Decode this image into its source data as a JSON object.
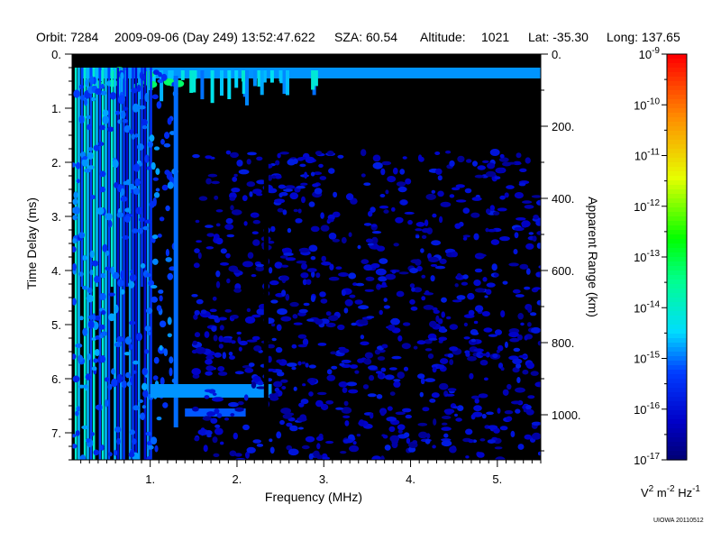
{
  "header": {
    "orbit": "Orbit: 7284",
    "datetime": "2009-09-06 (Day 249) 13:52:47.622",
    "sza": "SZA:  60.54",
    "altitude_label": "Altitude:",
    "altitude_value": "1021",
    "lat": "Lat: -35.30",
    "long": "Long: 137.65"
  },
  "credit": "UIOWA 20110512",
  "colors": {
    "background": "#000000",
    "low": "#0000c8",
    "mid": "#00e6ff",
    "high": "#00ff00",
    "yellow": "#ffff00",
    "max": "#ff0000"
  },
  "chart_data": {
    "type": "heatmap",
    "xlabel": "Frequency (MHz)",
    "ylabel": "Time Delay (ms)",
    "y2label": "Apparent Range (km)",
    "colorbar_unit": "V^2 m^-2 Hz^-1",
    "xlim": [
      0.1,
      5.5
    ],
    "ylim": [
      0,
      7.5
    ],
    "y2lim": [
      0,
      1125
    ],
    "x_ticks": [
      {
        "value": 1,
        "label": "1."
      },
      {
        "value": 2,
        "label": "2."
      },
      {
        "value": 3,
        "label": "3."
      },
      {
        "value": 4,
        "label": "4."
      },
      {
        "value": 5,
        "label": "5."
      }
    ],
    "y_ticks": [
      {
        "value": 0,
        "label": "0."
      },
      {
        "value": 1,
        "label": "1."
      },
      {
        "value": 2,
        "label": "2."
      },
      {
        "value": 3,
        "label": "3."
      },
      {
        "value": 4,
        "label": "4."
      },
      {
        "value": 5,
        "label": "5."
      },
      {
        "value": 6,
        "label": "6."
      },
      {
        "value": 7,
        "label": "7."
      }
    ],
    "y2_ticks": [
      {
        "value": 0,
        "label": "0."
      },
      {
        "value": 200,
        "label": "200."
      },
      {
        "value": 400,
        "label": "400."
      },
      {
        "value": 600,
        "label": "600."
      },
      {
        "value": 800,
        "label": "800."
      },
      {
        "value": 1000,
        "label": "1000."
      }
    ],
    "colorbar": {
      "scale": "log",
      "range": [
        -17,
        -9
      ],
      "ticks": [
        {
          "value": -9,
          "base": "10",
          "exp": "-9"
        },
        {
          "value": -10,
          "base": "10",
          "exp": "-10"
        },
        {
          "value": -11,
          "base": "10",
          "exp": "-11"
        },
        {
          "value": -12,
          "base": "10",
          "exp": "-12"
        },
        {
          "value": -13,
          "base": "10",
          "exp": "-13"
        },
        {
          "value": -14,
          "base": "10",
          "exp": "-14"
        },
        {
          "value": -15,
          "base": "10",
          "exp": "-15"
        },
        {
          "value": -16,
          "base": "10",
          "exp": "-16"
        },
        {
          "value": -17,
          "base": "10",
          "exp": "-17"
        }
      ]
    },
    "features": [
      {
        "name": "surface-echo",
        "x": [
          0.2,
          5.5
        ],
        "y": [
          0.2,
          0.5
        ],
        "log_intensity": -14.5
      },
      {
        "name": "low-frequency-harmonics",
        "x": [
          0.1,
          1.0
        ],
        "y": [
          0.0,
          7.5
        ],
        "log_intensity": -14.0
      },
      {
        "name": "echo-line-1.3mhz",
        "x": [
          1.25,
          1.35
        ],
        "y": [
          0.0,
          6.9
        ],
        "log_intensity": -15.0
      },
      {
        "name": "echo-at-6.2ms",
        "x": [
          1.0,
          2.4
        ],
        "y": [
          6.0,
          6.8
        ],
        "log_intensity": -14.8
      },
      {
        "name": "noise-cloud",
        "x": [
          1.5,
          5.5
        ],
        "y": [
          1.8,
          7.5
        ],
        "log_intensity": -16.2
      }
    ]
  }
}
